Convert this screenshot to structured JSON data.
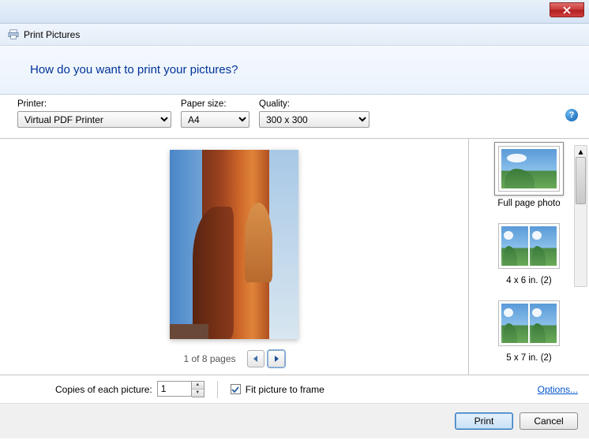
{
  "window": {
    "title": "Print Pictures"
  },
  "banner": {
    "question": "How do you want to print your pictures?"
  },
  "controls": {
    "printer_label": "Printer:",
    "printer_value": "Virtual PDF Printer",
    "paper_label": "Paper size:",
    "paper_value": "A4",
    "quality_label": "Quality:",
    "quality_value": "300 x 300"
  },
  "pager": {
    "text": "1 of 8 pages"
  },
  "layouts": [
    {
      "label": "Full page photo",
      "selected": true,
      "cells": 1
    },
    {
      "label": "4 x 6 in. (2)",
      "selected": false,
      "cells": 2
    },
    {
      "label": "5 x 7 in. (2)",
      "selected": false,
      "cells": 2
    }
  ],
  "bottom": {
    "copies_label": "Copies of each picture:",
    "copies_value": "1",
    "fit_label": "Fit picture to frame",
    "fit_checked": true,
    "options_link": "Options...",
    "print_btn": "Print",
    "cancel_btn": "Cancel"
  }
}
